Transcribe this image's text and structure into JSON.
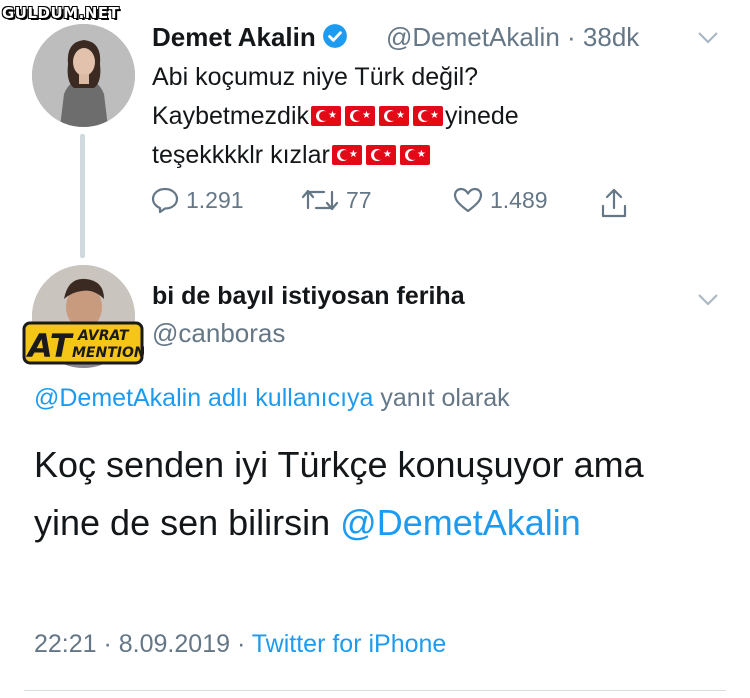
{
  "watermark": "GULDUM.NET",
  "tweet": {
    "name": "Demet Akalin",
    "handle": "@DemetAkalin",
    "time": "· 38dk",
    "line1": "Abi koçumuz niye Türk değil?",
    "line2_text": "Kaybetmezdik",
    "line2_suffix": "yinede",
    "line3_text": "teşekkkklr kızlar",
    "reply_count": "1.291",
    "retweet_count": "77",
    "like_count": "1.489"
  },
  "reply": {
    "name": "bi de bayıl istiyosan feriha",
    "handle": "@canboras",
    "badge_big": "AT",
    "badge_top": "AVRAT",
    "badge_bottom": "MENTION",
    "context_link": "@DemetAkalin adlı kullanıcıya",
    "context_suffix": "yanıt olarak",
    "text_line1": "Koç senden iyi Türkçe konuşuyor ama",
    "text_line2": "yine de sen bilirsin",
    "text_mention": "@DemetAkalin",
    "time": "22:21 · 8.09.2019 ·",
    "source": "Twitter for iPhone"
  },
  "colors": {
    "link": "#1d9bf0",
    "secondary": "#657786",
    "flag_red": "#e30a17",
    "badge_yellow": "#f5c518"
  }
}
